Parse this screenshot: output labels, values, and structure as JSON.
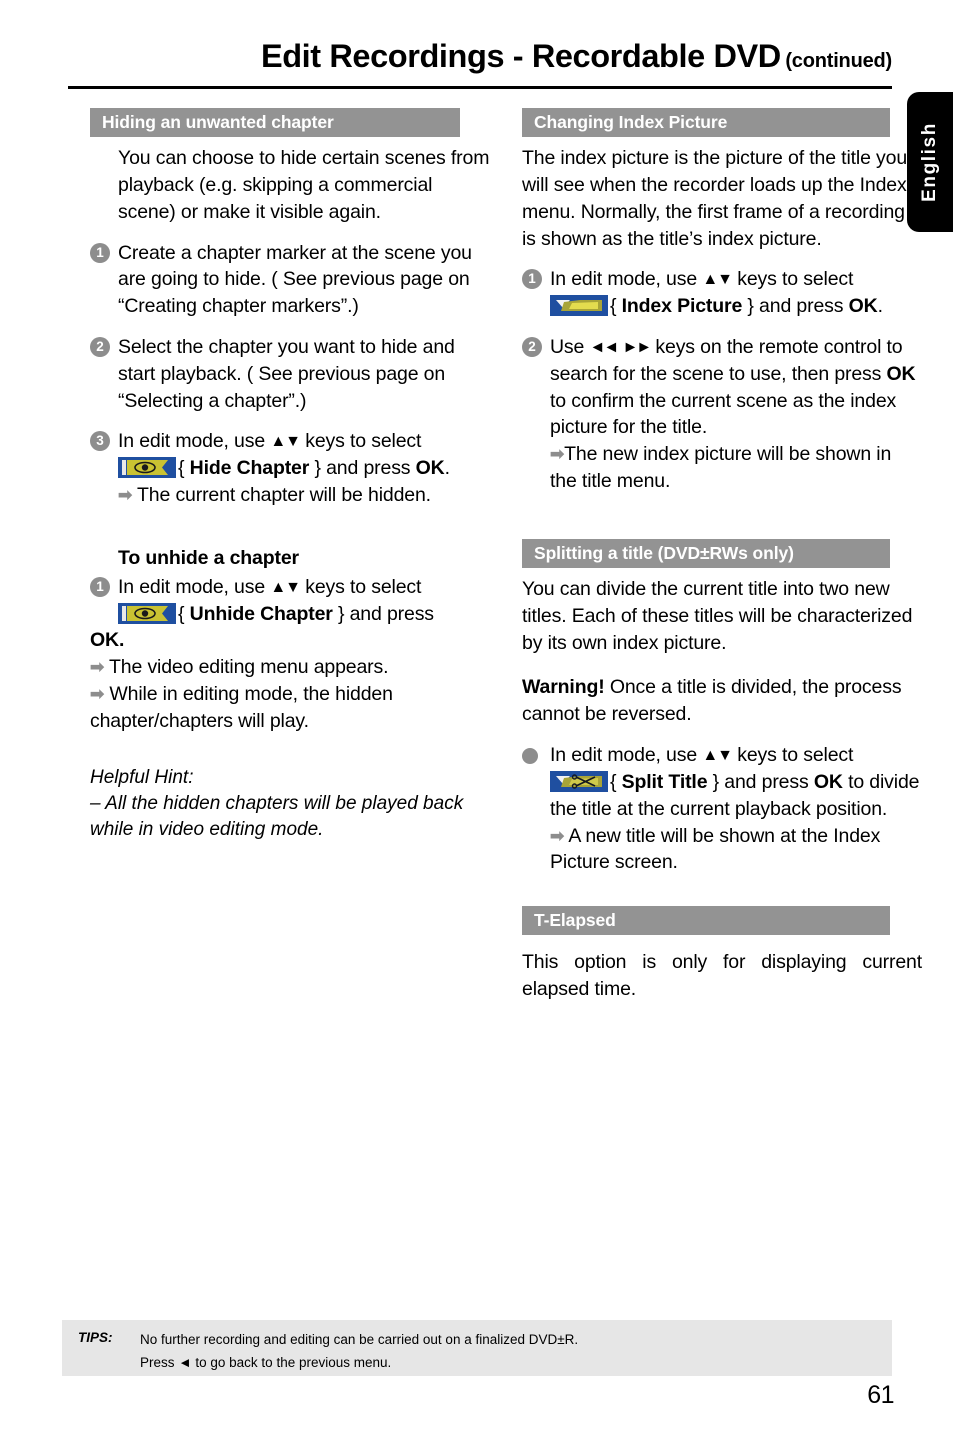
{
  "header": {
    "title": "Edit Recordings - Recordable DVD",
    "continued": "(continued)",
    "language_tab": "English"
  },
  "left_column": {
    "section1": {
      "heading": "Hiding an unwanted chapter",
      "intro": "You can choose to hide certain scenes from playback (e.g. skipping a commercial scene) or make it visible again.",
      "steps": [
        {
          "num": "1",
          "text": "Create a chapter marker at the scene you are going to hide. ( See previous page on “Creating chapter markers”.)"
        },
        {
          "num": "2",
          "text": "Select the chapter you want to hide and start playback. ( See previous page on “Selecting a chapter”.)"
        }
      ],
      "step3": {
        "num": "3",
        "line1_a": "In edit mode, use ",
        "line1_keys": "▲▼",
        "line1_b": " keys to select",
        "icon": "hide-chapter-icon",
        "brace_open": "{ ",
        "menu_item": "Hide Chapter",
        "brace_close": " } and press ",
        "ok": "OK",
        "period": ".",
        "result": "The current chapter will be hidden."
      },
      "unhide": {
        "heading": "To unhide a chapter",
        "num": "1",
        "line1_a": "In edit mode, use ",
        "line1_keys": "▲▼",
        "line1_b": " keys to select",
        "icon": "unhide-chapter-icon",
        "brace_open": "{ ",
        "menu_item": "Unhide Chapter",
        "brace_close": " } and press",
        "ok": "OK.",
        "result1": "The video editing menu appears.",
        "result2_a": "While in editing mode, the hidden",
        "result2_b": "chapter/chapters will play."
      },
      "hint": {
        "label": "Helpful Hint:",
        "text": "– All the hidden chapters will be played back while in video editing mode."
      }
    }
  },
  "right_column": {
    "section_index": {
      "heading": "Changing Index Picture",
      "intro": "The index picture is the picture of the title you will see when the recorder loads up the Index menu. Normally, the first frame of a recording is shown as the title’s index picture.",
      "step1": {
        "num": "1",
        "line1_a": "In edit mode, use ",
        "line1_keys": "▲▼",
        "line1_b": " keys to select",
        "icon": "index-picture-icon",
        "brace_open": "{ ",
        "menu_item": "Index Picture",
        "brace_close": " } and press ",
        "ok": "OK",
        "period": "."
      },
      "step2": {
        "num": "2",
        "a": "Use ",
        "keys_rew": "◄◄",
        "keys_gap": "   ",
        "keys_ff": "►►",
        "b": " keys on the remote control to search for the scene to use, then press ",
        "ok": "OK",
        "c": " to confirm the current scene as the index picture for the title.",
        "result": "The new index picture will be shown in the title menu."
      }
    },
    "section_split": {
      "heading": "Splitting a title (DVD±RWs only)",
      "intro": "You can divide the current title into two new titles. Each of these titles will be characterized by its own index picture.",
      "warning_label": "Warning!",
      "warning_text": " Once a title is divided, the process cannot be reversed.",
      "bullet": {
        "line1_a": "In edit mode, use ",
        "line1_keys": "▲▼",
        "line1_b": " keys to select",
        "icon": "split-title-icon",
        "brace_open": "{ ",
        "menu_item": "Split Title",
        "brace_close": " } and press ",
        "ok": "OK",
        "tail": " to divide the title at the current playback position.",
        "result": "A new title will be shown at the Index Picture screen."
      }
    },
    "section_elapsed": {
      "heading": "T-Elapsed",
      "text": "This option is only for displaying current elapsed time."
    }
  },
  "footer": {
    "tips_label": "TIPS:",
    "tips_line1": "No further recording and editing can be carried out on a finalized DVD±R.",
    "tips_line2_a": "Press ",
    "tips_line2_key": "◄",
    "tips_line2_b": " to go back to the previous menu.",
    "page_number": "61"
  },
  "colors": {
    "section_bar": "#939393",
    "step_circle": "#8d8d8d",
    "icon_chip_blue": "#1f4fa0",
    "icon_yellow": "#c9c232",
    "tips_band": "#e6e6e6"
  }
}
